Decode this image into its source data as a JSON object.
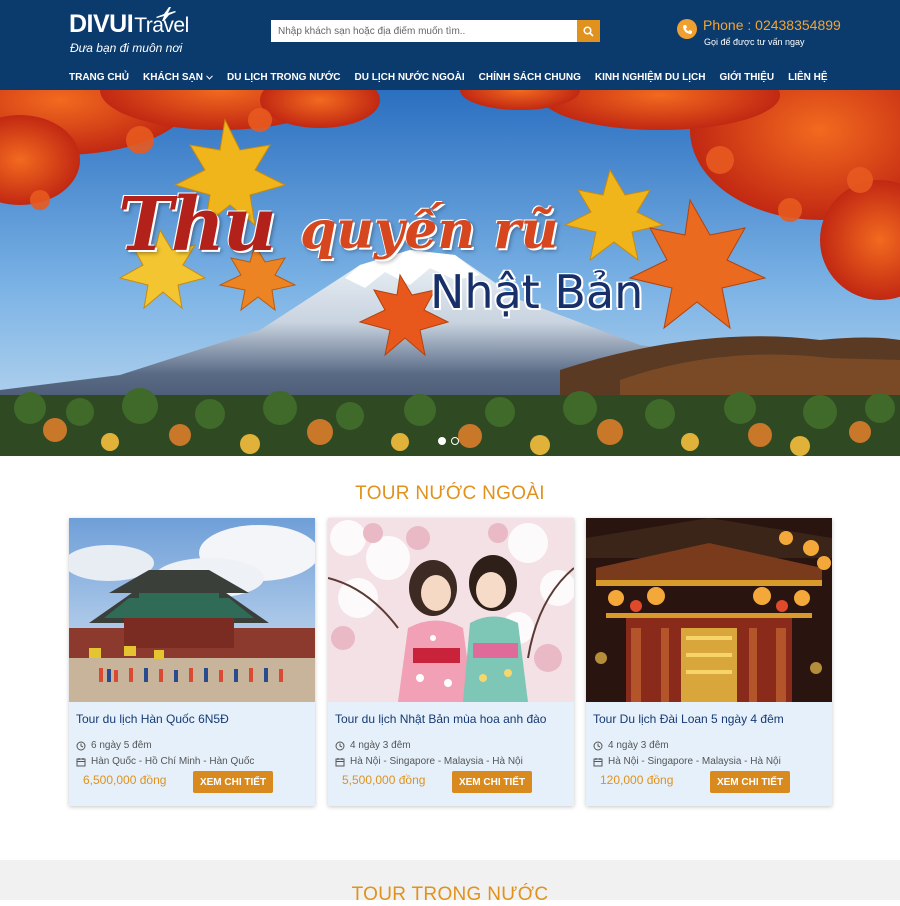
{
  "header": {
    "logo_bold": "DIVUI",
    "logo_light": "Travel",
    "tagline": "Đưa bạn đi muôn nơi",
    "search_placeholder": "Nhập khách sạn hoặc địa điểm muốn tìm..",
    "phone": "Phone : 02438354899",
    "phone_sub": "Gọi để được tư vấn ngay",
    "accent": "#e0921c",
    "bg": "#0b3a6d"
  },
  "nav": {
    "items": [
      {
        "label": "TRANG CHỦ"
      },
      {
        "label": "KHÁCH SẠN",
        "dropdown": true
      },
      {
        "label": "DU LỊCH TRONG NƯỚC"
      },
      {
        "label": "DU LỊCH NƯỚC NGOÀI"
      },
      {
        "label": "CHÍNH SÁCH CHUNG"
      },
      {
        "label": "KINH NGHIỆM DU LỊCH"
      },
      {
        "label": "GIỚI THIỆU"
      },
      {
        "label": "LIÊN HỆ"
      }
    ]
  },
  "banner": {
    "line1": "Thu",
    "line2": "quyến rũ",
    "line3": "Nhật Bản",
    "slides": 2,
    "active_slide": 1
  },
  "tours_abroad": {
    "title": "TOUR NƯỚC NGOÀI",
    "cards": [
      {
        "title": "Tour du lịch Hàn Quốc 6N5Đ",
        "duration": "6 ngày 5 đêm",
        "route": "Hàn Quốc - Hồ Chí Minh - Hàn Quốc",
        "price": "6,500,000 đồng",
        "button": "XEM CHI TIẾT"
      },
      {
        "title": "Tour du lịch Nhật Bản mùa hoa anh đào",
        "duration": "4 ngày 3 đêm",
        "route": "Hà Nội - Singapore - Malaysia - Hà Nội",
        "price": "5,500,000 đồng",
        "button": "XEM CHI TIẾT"
      },
      {
        "title": "Tour Du lịch Đài Loan 5 ngày 4 đêm",
        "duration": "4 ngày 3 đêm",
        "route": "Hà Nội - Singapore - Malaysia - Hà Nội",
        "price": "120,000 đồng",
        "button": "XEM CHI TIẾT"
      }
    ]
  },
  "tours_domestic": {
    "title": "TOUR TRONG NƯỚC"
  }
}
